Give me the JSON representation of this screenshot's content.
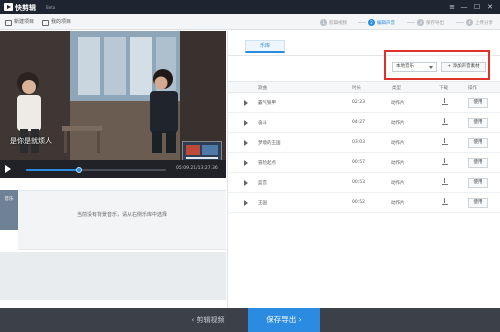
{
  "app": {
    "title": "快剪辑",
    "beta": "Beta"
  },
  "window_controls": {
    "menu": "≡",
    "minimize": "—",
    "maximize": "☐",
    "close": "✕"
  },
  "toolbar": {
    "new_project": "新建项目",
    "my_projects": "我的项目"
  },
  "steps": [
    {
      "num": "1",
      "label": "剪辑视频",
      "active": false
    },
    {
      "num": "2",
      "label": "编辑声音",
      "active": true
    },
    {
      "num": "3",
      "label": "保存导出",
      "active": false
    },
    {
      "num": "4",
      "label": "上传分享",
      "active": false
    }
  ],
  "video": {
    "subtitle": "是你是就烦人",
    "pip_label": ""
  },
  "playback": {
    "timecode": "05:09.21/13:27.36",
    "progress": 0.38
  },
  "timeline": {
    "track_label": "音乐",
    "hint": "当前没有背景音乐，请从右侧乐库中选择"
  },
  "bottom": {
    "back_label": "剪辑视频",
    "export_label": "保存导出"
  },
  "panel": {
    "tab": "乐库",
    "source_select": "本地音乐",
    "add_button": "添加声音素材"
  },
  "table": {
    "headers": {
      "name": "歌曲",
      "duration": "时长",
      "type": "类型",
      "download": "下载",
      "action": "操作"
    },
    "rows": [
      {
        "name": "霸气铁甲",
        "duration": "02:23",
        "type": "动作片"
      },
      {
        "name": "奋斗",
        "duration": "04:27",
        "type": "动作片"
      },
      {
        "name": "梦境的王国",
        "duration": "03:03",
        "type": "动作片"
      },
      {
        "name": "冒险起点",
        "duration": "00:57",
        "type": "动作片"
      },
      {
        "name": "蓝宫",
        "duration": "00:53",
        "type": "动作片"
      },
      {
        "name": "王国",
        "duration": "00:52",
        "type": "动作片"
      }
    ],
    "use_label": "使用"
  },
  "colors": {
    "accent": "#2b8be0",
    "highlight_box": "#e0302c",
    "titlebar": "#1e2530"
  }
}
